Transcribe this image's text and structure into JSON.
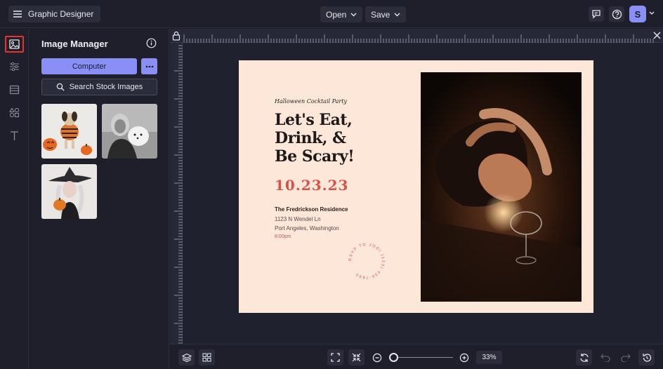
{
  "app": {
    "title": "Graphic Designer"
  },
  "topbar": {
    "open_label": "Open",
    "save_label": "Save",
    "avatar_initial": "S",
    "icons": [
      "menu-icon",
      "chat-icon",
      "help-icon",
      "chevron-down-icon"
    ]
  },
  "rail": {
    "items": [
      "image-icon",
      "sliders-icon",
      "layout-icon",
      "shapes-icon",
      "text-icon"
    ],
    "active": "image-icon"
  },
  "panel": {
    "title": "Image Manager",
    "computer_label": "Computer",
    "more_icon": "ellipsis-icon",
    "stock_label": "Search Stock Images",
    "thumbnails": [
      "dog-halloween-thumbnail",
      "woman-with-dog-thumbnail",
      "witch-costume-thumbnail"
    ]
  },
  "card": {
    "subtitle": "Halloween Cocktail Party",
    "headline_1": "Let's Eat,",
    "headline_2": "Drink, &",
    "headline_3": "Be Scary!",
    "date": "10.23.23",
    "venue": "The Fredrickson Residence",
    "address_1": "1123 N Wendel Ln",
    "address_2": "Port Angeles, Washington",
    "time": "8:00pm",
    "rsvp_text": "RSVP TO JODI (123) 456-7890"
  },
  "bottombar": {
    "zoom_label": "33%",
    "zoom_fraction": 0.0
  },
  "colors": {
    "accent": "#8a8ff5",
    "card_bg": "#fde7d9",
    "date": "#d9524a",
    "active_outline": "#e5322d"
  }
}
